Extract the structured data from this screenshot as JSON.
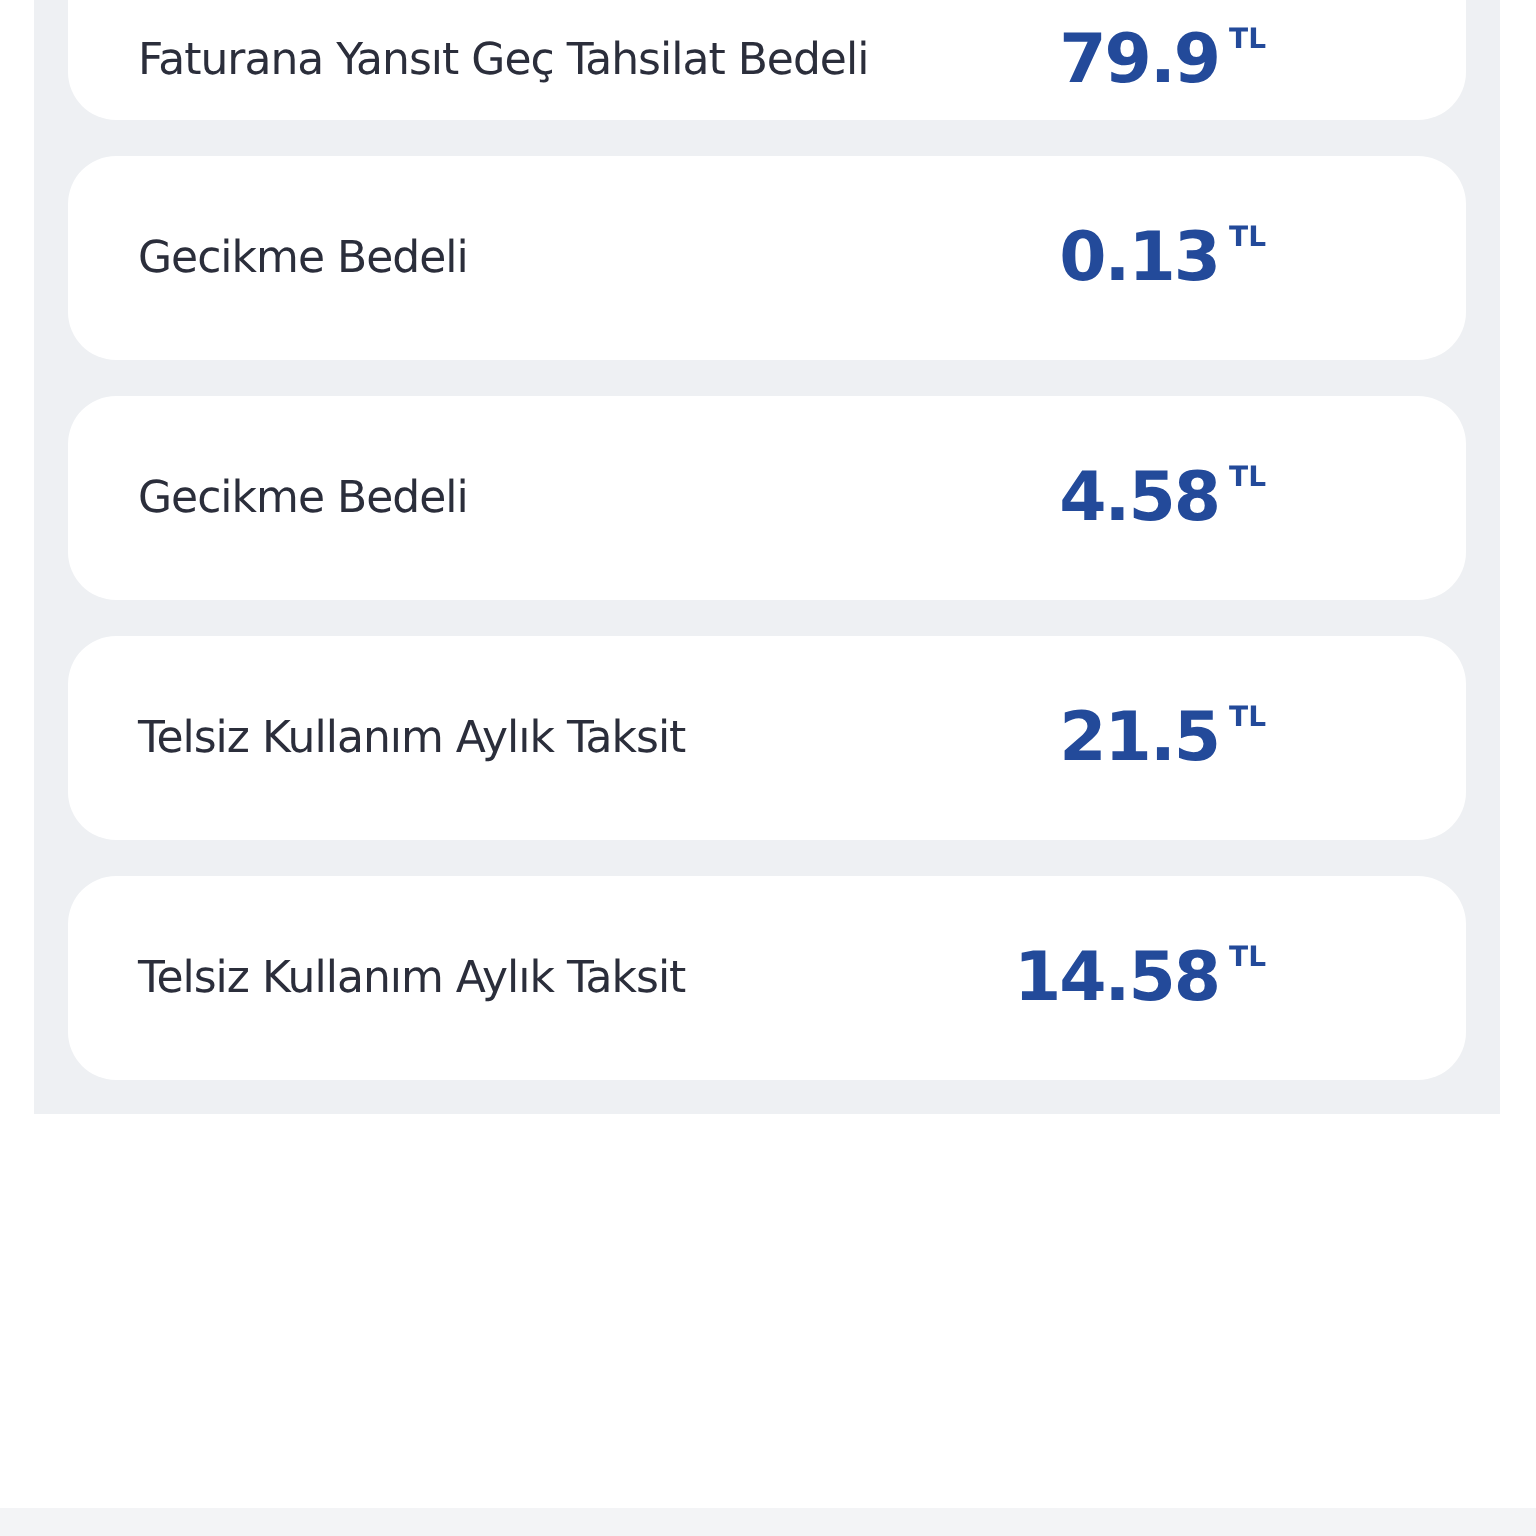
{
  "items": [
    {
      "label": "Faturana Yansıt Geç Tahsilat Bedeli",
      "amount": "79.9",
      "currency": "TL"
    },
    {
      "label": "Gecikme Bedeli",
      "amount": "0.13",
      "currency": "TL"
    },
    {
      "label": "Gecikme Bedeli",
      "amount": "4.58",
      "currency": "TL"
    },
    {
      "label": "Telsiz Kullanım Aylık Taksit",
      "amount": "21.5",
      "currency": "TL"
    },
    {
      "label": "Telsiz Kullanım Aylık Taksit",
      "amount": "14.58",
      "currency": "TL"
    }
  ]
}
